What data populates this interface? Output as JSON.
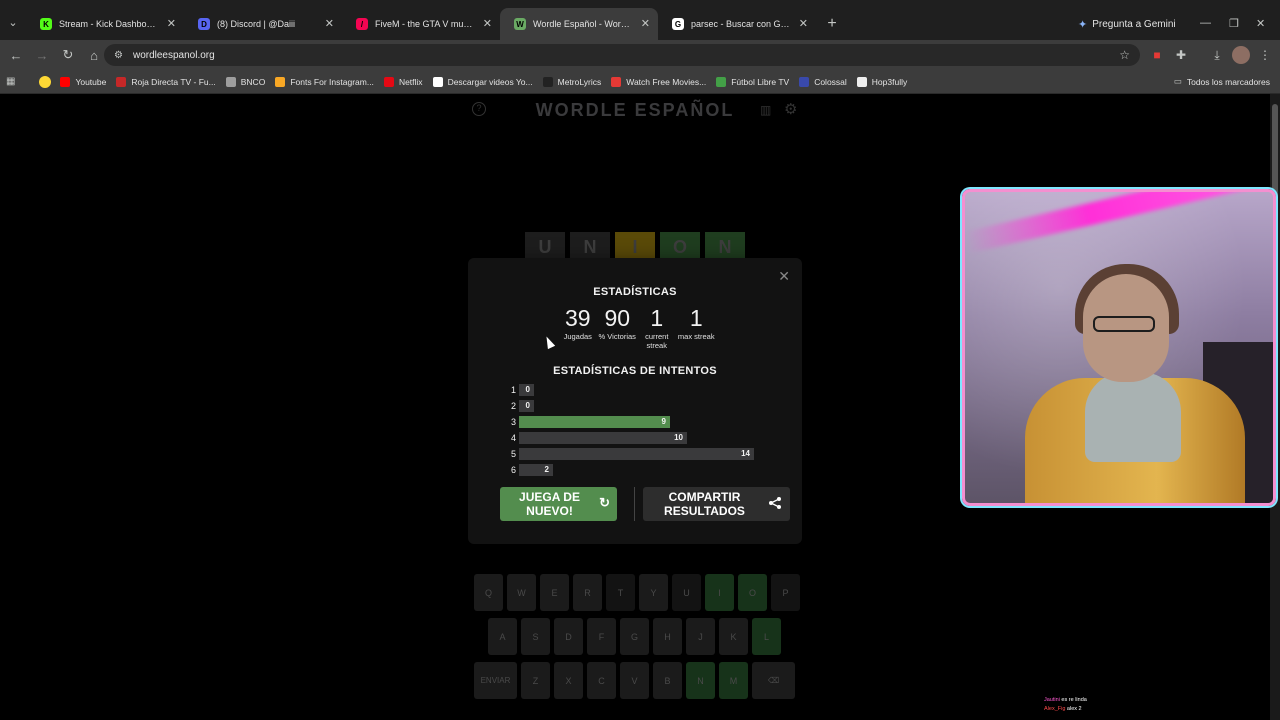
{
  "browser": {
    "tabs": [
      {
        "title": "Stream - Kick Dashboard",
        "favicon": "K",
        "favicon_color": "#53fc18",
        "active": false
      },
      {
        "title": "(8) Discord | @Daiii",
        "favicon": "D",
        "favicon_color": "#5865f2",
        "active": false
      },
      {
        "title": "FiveM - the GTA V multiplayer",
        "favicon": "/",
        "favicon_color": "#f40552",
        "active": false
      },
      {
        "title": "Wordle Español - Wordle ilimit",
        "favicon": "W",
        "favicon_color": "#6aaa64",
        "active": true
      },
      {
        "title": "parsec - Buscar con Google",
        "favicon": "G",
        "favicon_color": "#ffffff",
        "active": false
      }
    ],
    "gemini_label": "Pregunta a Gemini",
    "url": "wordleespanol.org",
    "bookmarks": [
      {
        "label": "Youtube",
        "color": "#ff0000"
      },
      {
        "label": "Roja Directa TV - Fu...",
        "color": "#c62828"
      },
      {
        "label": "BNCO",
        "color": "#9e9e9e"
      },
      {
        "label": "Fonts For Instagram...",
        "color": "#f9a825"
      },
      {
        "label": "Netflix",
        "color": "#e50914"
      },
      {
        "label": "Descargar videos Yo...",
        "color": "#ffffff"
      },
      {
        "label": "MetroLyrics",
        "color": "#222222"
      },
      {
        "label": "Watch Free Movies...",
        "color": "#e53935"
      },
      {
        "label": "Fútbol Libre TV",
        "color": "#43a047"
      },
      {
        "label": "Colossal",
        "color": "#3949ab"
      },
      {
        "label": "Hop3fully",
        "color": "#eeeeee"
      }
    ],
    "all_bookmarks": "Todos los marcadores"
  },
  "game": {
    "title": "WORDLE ESPAÑOL",
    "board_row": [
      {
        "letter": "U",
        "state": "absent"
      },
      {
        "letter": "N",
        "state": "absent"
      },
      {
        "letter": "I",
        "state": "present"
      },
      {
        "letter": "O",
        "state": "correct"
      },
      {
        "letter": "N",
        "state": "correct"
      }
    ],
    "keyboard": {
      "row1": [
        {
          "k": "Q",
          "s": "unused"
        },
        {
          "k": "W",
          "s": "unused"
        },
        {
          "k": "E",
          "s": "unused"
        },
        {
          "k": "R",
          "s": "unused"
        },
        {
          "k": "T",
          "s": "absent"
        },
        {
          "k": "Y",
          "s": "unused"
        },
        {
          "k": "U",
          "s": "absent"
        },
        {
          "k": "I",
          "s": "correct"
        },
        {
          "k": "O",
          "s": "correct"
        },
        {
          "k": "P",
          "s": "absent"
        }
      ],
      "row2": [
        {
          "k": "A",
          "s": "unused"
        },
        {
          "k": "S",
          "s": "unused"
        },
        {
          "k": "D",
          "s": "unused"
        },
        {
          "k": "F",
          "s": "unused"
        },
        {
          "k": "G",
          "s": "unused"
        },
        {
          "k": "H",
          "s": "unused"
        },
        {
          "k": "J",
          "s": "unused"
        },
        {
          "k": "K",
          "s": "unused"
        },
        {
          "k": "L",
          "s": "correct"
        }
      ],
      "row3": [
        {
          "k": "ENVIAR",
          "s": "unused"
        },
        {
          "k": "Z",
          "s": "unused"
        },
        {
          "k": "X",
          "s": "unused"
        },
        {
          "k": "C",
          "s": "unused"
        },
        {
          "k": "V",
          "s": "unused"
        },
        {
          "k": "B",
          "s": "unused"
        },
        {
          "k": "N",
          "s": "correct"
        },
        {
          "k": "M",
          "s": "correct"
        },
        {
          "k": "⌫",
          "s": "unused"
        }
      ]
    }
  },
  "modal": {
    "heading": "ESTADÍSTICAS",
    "stats": [
      {
        "num": "39",
        "label": "Jugadas"
      },
      {
        "num": "90",
        "label": "% Victorias"
      },
      {
        "num": "1",
        "label": "current streak"
      },
      {
        "num": "1",
        "label": "max streak"
      }
    ],
    "distribution_heading": "ESTADÍSTICAS DE INTENTOS",
    "distribution": [
      {
        "guess": "1",
        "count": 0,
        "current": false
      },
      {
        "guess": "2",
        "count": 0,
        "current": false
      },
      {
        "guess": "3",
        "count": 9,
        "current": true
      },
      {
        "guess": "4",
        "count": 10,
        "current": false
      },
      {
        "guess": "5",
        "count": 14,
        "current": false
      },
      {
        "guess": "6",
        "count": 2,
        "current": false
      }
    ],
    "play_again": "JUEGA DE NUEVO!",
    "share": "COMPARTIR RESULTADOS"
  },
  "chat": [
    {
      "user": "Jautini",
      "text": "es re linda"
    },
    {
      "user": "Alex_Fig",
      "text": "alex 2"
    }
  ]
}
